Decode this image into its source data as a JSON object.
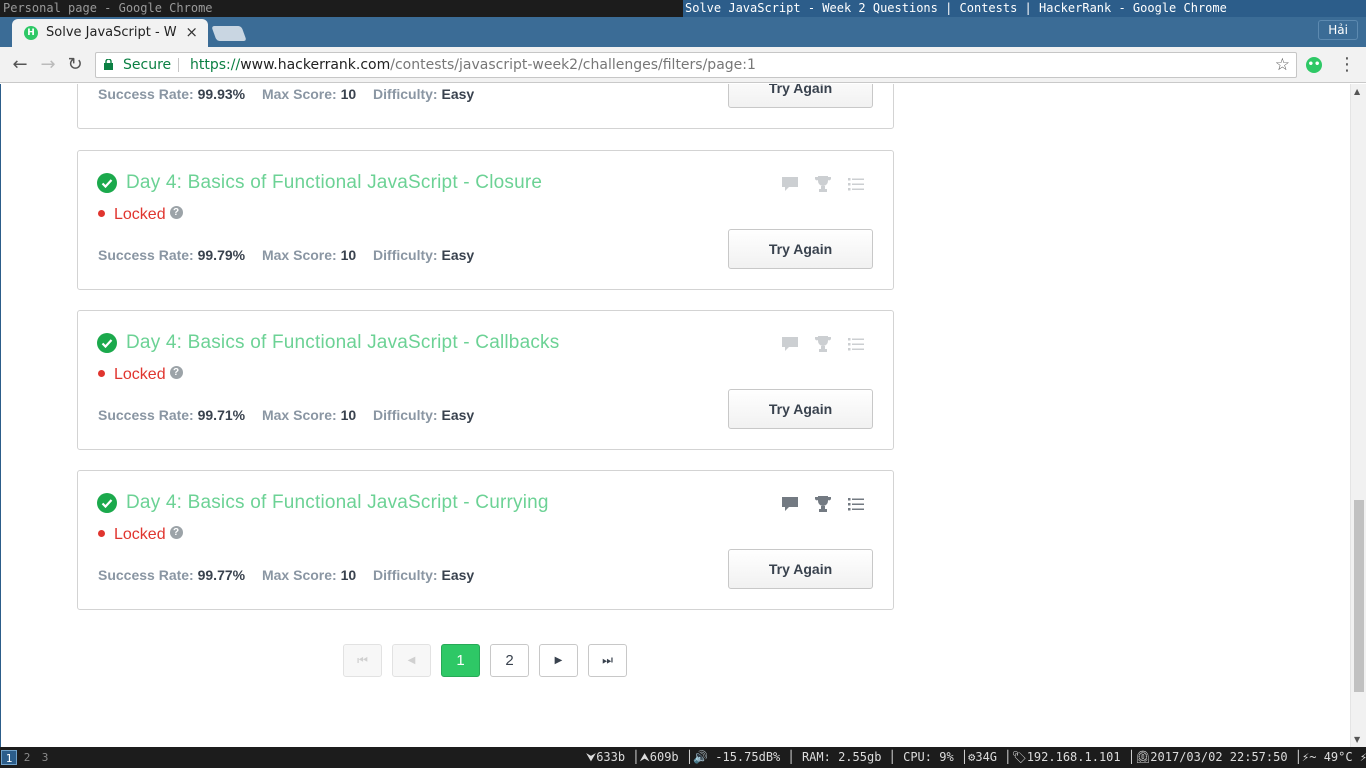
{
  "wm": {
    "left_title": "Personal page - Google Chrome",
    "right_title": "Solve JavaScript - Week 2 Questions | Contests | HackerRank - Google Chrome"
  },
  "browser": {
    "tab_title": "Solve JavaScript - W",
    "tab_close": "×",
    "favicon_letter": "H",
    "user": "Hải",
    "secure_label": "Secure",
    "url_scheme": "https://",
    "url_host": "www.hackerrank.com",
    "url_path": "/contests/javascript-week2/challenges/filters/page:1",
    "star": "☆",
    "back": "←",
    "forward": "→",
    "reload": "↻",
    "menu": "⋮",
    "ext_letter": "••"
  },
  "partial_card": {
    "stats": {
      "success_label": "Success Rate:",
      "success": "99.93%",
      "score_label": "Max Score:",
      "score": "10",
      "difficulty_label": "Difficulty:",
      "difficulty": "Easy"
    },
    "button": "Try Again"
  },
  "challenges": [
    {
      "title": "Day 4: Basics of Functional JavaScript - Closure",
      "status": "Locked",
      "help": "?",
      "success_label": "Success Rate:",
      "success": "99.79%",
      "score_label": "Max Score:",
      "score": "10",
      "difficulty_label": "Difficulty:",
      "difficulty": "Easy",
      "button": "Try Again"
    },
    {
      "title": "Day 4: Basics of Functional JavaScript - Callbacks",
      "status": "Locked",
      "help": "?",
      "success_label": "Success Rate:",
      "success": "99.71%",
      "score_label": "Max Score:",
      "score": "10",
      "difficulty_label": "Difficulty:",
      "difficulty": "Easy",
      "button": "Try Again"
    },
    {
      "title": "Day 4: Basics of Functional JavaScript - Currying",
      "status": "Locked",
      "help": "?",
      "success_label": "Success Rate:",
      "success": "99.77%",
      "score_label": "Max Score:",
      "score": "10",
      "difficulty_label": "Difficulty:",
      "difficulty": "Easy",
      "button": "Try Again"
    }
  ],
  "pagination": {
    "first": "⏮",
    "prev": "◀",
    "pages": [
      "1",
      "2"
    ],
    "current": "1",
    "next": "▶",
    "last": "⏭"
  },
  "statusbar": {
    "workspaces": [
      "1",
      "2",
      "3"
    ],
    "active_workspace": "1",
    "info": "⮟633b │⮝609b │🔊 -15.75dB% │ RAM: 2.55gb │ CPU: 9% │⚙34G │🏷192.168.1.101 │⏲2017/03/02 22:57:50 │⚡~ 49°C ⚡"
  },
  "colors": {
    "accent_green": "#2ec866",
    "title_green": "#6cd295",
    "locked_red": "#e0352f",
    "chrome_blue": "#3b6c96"
  }
}
